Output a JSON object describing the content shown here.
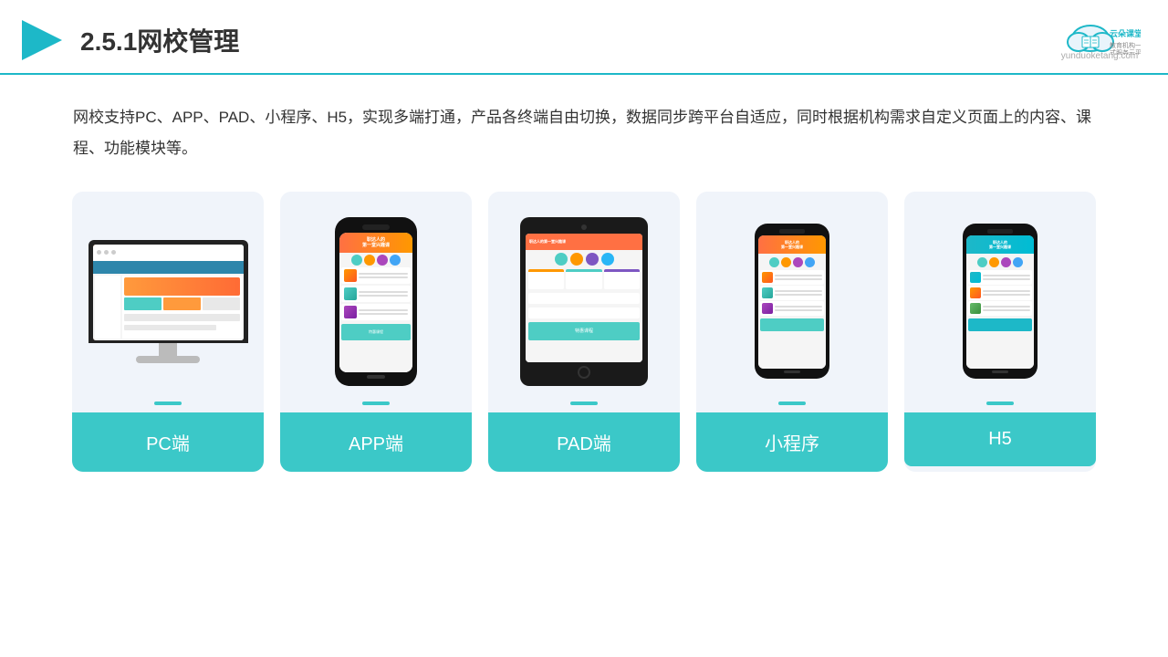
{
  "header": {
    "title": "2.5.1网校管理",
    "logo_brand": "云朵课堂",
    "logo_url": "yunduoketang.com",
    "logo_tagline": "教育机构一站式服务云平台"
  },
  "description": "网校支持PC、APP、PAD、小程序、H5，实现多端打通，产品各终端自由切换，数据同步跨平台自适应，同时根据机构需求自定义页面上的内容、课程、功能模块等。",
  "cards": [
    {
      "label": "PC端",
      "type": "pc"
    },
    {
      "label": "APP端",
      "type": "phone"
    },
    {
      "label": "PAD端",
      "type": "tablet"
    },
    {
      "label": "小程序",
      "type": "phone-mini"
    },
    {
      "label": "H5",
      "type": "phone-mini"
    }
  ],
  "accent_color": "#3bc8c8"
}
